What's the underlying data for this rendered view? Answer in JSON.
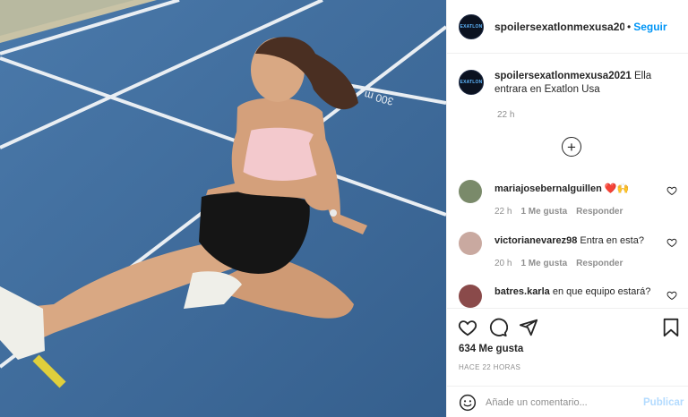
{
  "post": {
    "username": "spoilersexatlonmexusa2021",
    "header_username": "spoilersexatlonmexusa202",
    "follow_label": "Seguir",
    "dot": "•",
    "avatar_text": "EXATLON",
    "caption_text": "Ella entrara en Exatlon Usa",
    "caption_time": "22 h",
    "track_marking": "300 m"
  },
  "comments": [
    {
      "username": "mariajosebernalguillen",
      "text": "❤️🙌",
      "time": "22 h",
      "likes": "1 Me gusta",
      "reply": "Responder",
      "avatar_color": "#7a8a6a"
    },
    {
      "username": "victorianevarez98",
      "text": "Entra en esta?",
      "time": "20 h",
      "likes": "1 Me gusta",
      "reply": "Responder",
      "avatar_color": "#c9a9a0"
    },
    {
      "username": "batres.karla",
      "text": "en que equipo estará?",
      "time": "",
      "likes": "",
      "reply": "",
      "avatar_color": "#8a4a4a"
    }
  ],
  "footer": {
    "likes": "634 Me gusta",
    "posted": "HACE 22 HORAS",
    "comment_placeholder": "Añade un comentario...",
    "publish_label": "Publicar"
  },
  "icons": [
    "heart-icon",
    "comment-icon",
    "share-icon",
    "bookmark-icon",
    "emoji-icon",
    "plus-circle-icon"
  ],
  "colors": {
    "accent": "#0095f6",
    "publish_disabled": "#b3dbff",
    "track": "#3f6b9a"
  }
}
